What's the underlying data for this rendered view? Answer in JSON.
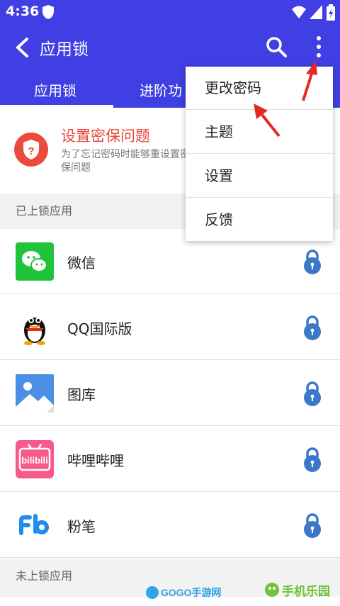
{
  "status_bar": {
    "time": "4:36"
  },
  "app_bar": {
    "title": "应用锁"
  },
  "tabs": [
    {
      "label": "应用锁"
    },
    {
      "label": "进阶功"
    }
  ],
  "security_card": {
    "title": "设置密保问题",
    "description": "为了忘记密码时能够重设置密保问题"
  },
  "locked_section": {
    "title": "已上锁应用"
  },
  "apps": [
    {
      "name": "微信"
    },
    {
      "name": "QQ国际版"
    },
    {
      "name": "图库"
    },
    {
      "name": "哔哩哔哩"
    },
    {
      "name": "粉笔"
    }
  ],
  "unlocked_section": {
    "title": "未上锁应用"
  },
  "menu": {
    "items": [
      {
        "label": "更改密码"
      },
      {
        "label": "主题"
      },
      {
        "label": "设置"
      },
      {
        "label": "反馈"
      }
    ]
  },
  "watermarks": {
    "left": "GOGO手游网",
    "right": "手机乐园"
  },
  "colors": {
    "primary": "#3f3fe3",
    "danger": "#e9433a",
    "lock": "#3b78c8"
  }
}
